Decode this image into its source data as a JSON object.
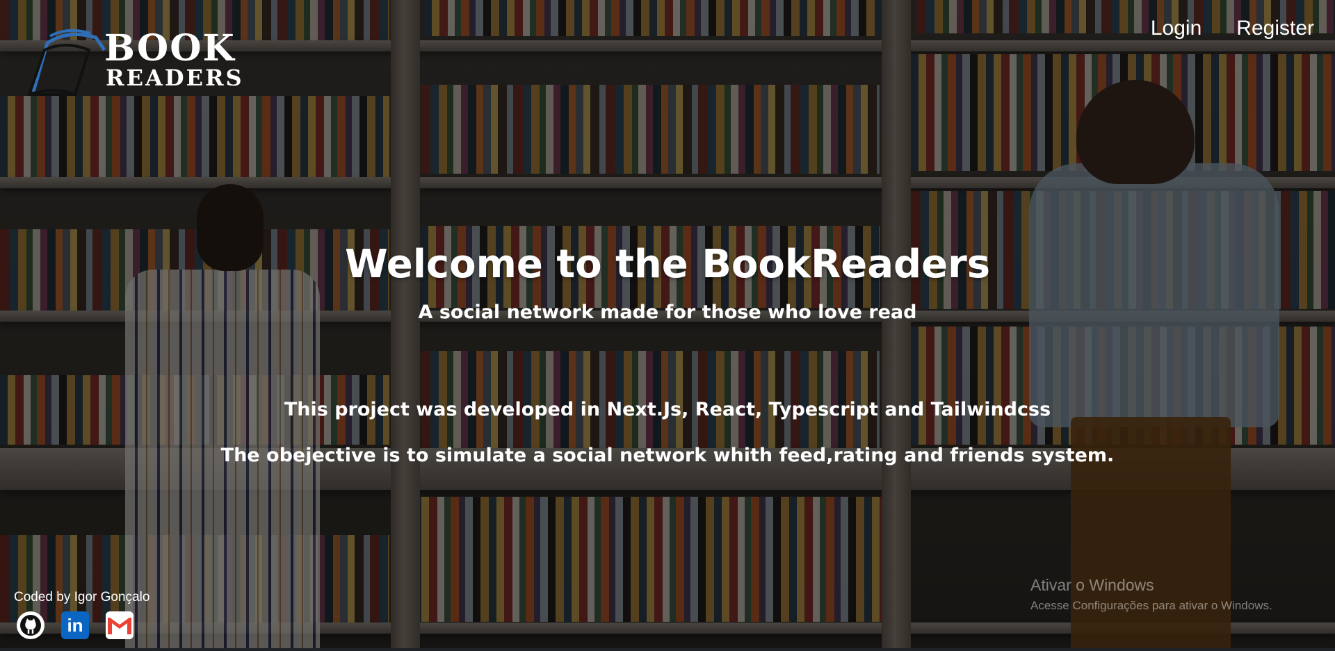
{
  "logo": {
    "line1": "BOOK",
    "line2": "READERS",
    "icon": "open-book-icon"
  },
  "nav": {
    "login": "Login",
    "register": "Register"
  },
  "hero": {
    "title": "Welcome to the BookReaders",
    "subtitle": "A social network made for those who love read",
    "description_1": "This project was developed in Next.Js, React, Typescript and Tailwindcss",
    "description_2": "The obejective is to simulate a social network whith feed,rating and friends system."
  },
  "footer": {
    "credit": "Coded by Igor Gonçalo",
    "socials": [
      {
        "icon": "github-icon"
      },
      {
        "icon": "linkedin-icon",
        "text": "in"
      },
      {
        "icon": "gmail-icon"
      }
    ]
  },
  "windows_watermark": {
    "title": "Ativar o Windows",
    "subtitle": "Acesse Configurações para ativar o Windows."
  },
  "colors": {
    "text": "#ffffff",
    "linkedin": "#0a66c2",
    "gmail_red": "#ea4335",
    "logo_blue": "#2f6fb7"
  }
}
